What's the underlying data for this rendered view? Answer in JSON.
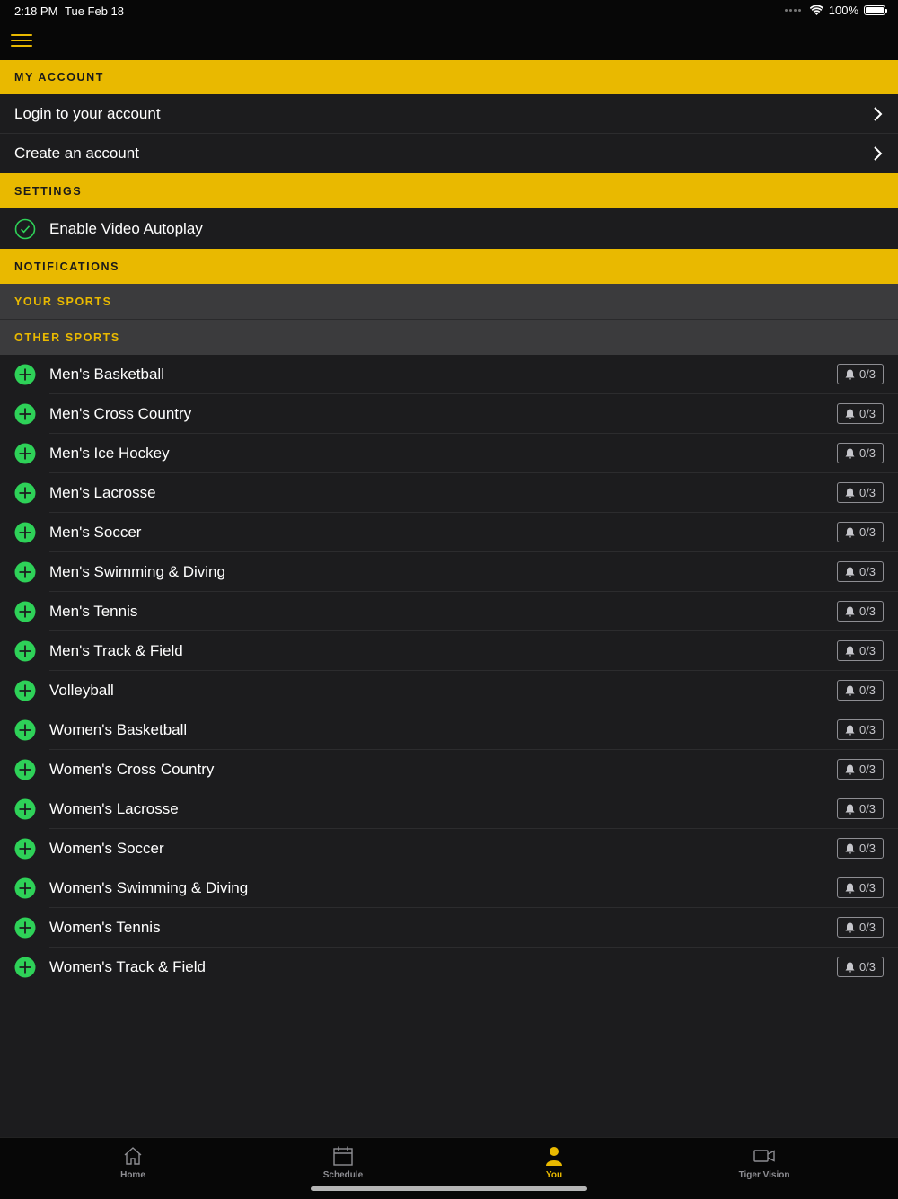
{
  "status": {
    "time": "2:18 PM",
    "date": "Tue Feb 18",
    "battery": "100%"
  },
  "sections": {
    "account": "MY ACCOUNT",
    "settings": "SETTINGS",
    "notifications": "NOTIFICATIONS",
    "your_sports": "YOUR SPORTS",
    "other_sports": "OTHER SPORTS"
  },
  "account": {
    "login": "Login to your account",
    "create": "Create an account"
  },
  "settings": {
    "autoplay": "Enable Video Autoplay"
  },
  "sports": [
    {
      "name": "Men's Basketball",
      "count": "0/3"
    },
    {
      "name": "Men's Cross Country",
      "count": "0/3"
    },
    {
      "name": "Men's Ice Hockey",
      "count": "0/3"
    },
    {
      "name": "Men's Lacrosse",
      "count": "0/3"
    },
    {
      "name": "Men's Soccer",
      "count": "0/3"
    },
    {
      "name": "Men's Swimming & Diving",
      "count": "0/3"
    },
    {
      "name": "Men's Tennis",
      "count": "0/3"
    },
    {
      "name": "Men's Track & Field",
      "count": "0/3"
    },
    {
      "name": "Volleyball",
      "count": "0/3"
    },
    {
      "name": "Women's Basketball",
      "count": "0/3"
    },
    {
      "name": "Women's Cross Country",
      "count": "0/3"
    },
    {
      "name": "Women's Lacrosse",
      "count": "0/3"
    },
    {
      "name": "Women's Soccer",
      "count": "0/3"
    },
    {
      "name": "Women's Swimming & Diving",
      "count": "0/3"
    },
    {
      "name": "Women's Tennis",
      "count": "0/3"
    },
    {
      "name": "Women's Track & Field",
      "count": "0/3"
    }
  ],
  "tabs": [
    {
      "label": "Home",
      "icon": "home-icon"
    },
    {
      "label": "Schedule",
      "icon": "calendar-icon"
    },
    {
      "label": "You",
      "icon": "person-icon"
    },
    {
      "label": "Tiger Vision",
      "icon": "video-camera-icon"
    }
  ],
  "colors": {
    "accent": "#e9b900",
    "background": "#1c1c1e",
    "add": "#2ed158"
  }
}
